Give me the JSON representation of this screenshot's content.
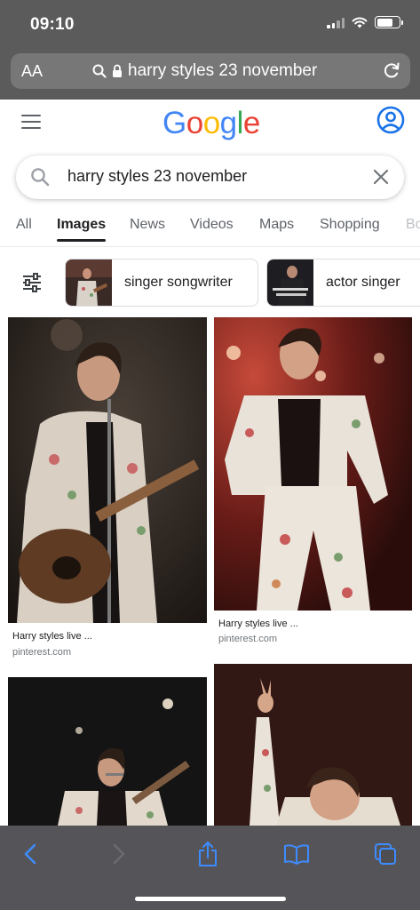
{
  "status_bar": {
    "time": "09:10",
    "battery_level": 0.72
  },
  "browser": {
    "text_size_label": "AA",
    "url_text": "harry styles 23 november",
    "icons": [
      "search-icon",
      "lock-icon",
      "reload-icon"
    ]
  },
  "google": {
    "logo_letters": [
      {
        "ch": "G",
        "color": "#4285F4"
      },
      {
        "ch": "o",
        "color": "#EA4335"
      },
      {
        "ch": "o",
        "color": "#FBBC05"
      },
      {
        "ch": "g",
        "color": "#4285F4"
      },
      {
        "ch": "l",
        "color": "#34A853"
      },
      {
        "ch": "e",
        "color": "#EA4335"
      }
    ],
    "search_value": "harry styles 23 november",
    "account_color": "#1a73e8"
  },
  "tabs": [
    {
      "label": "All"
    },
    {
      "label": "Images",
      "active": true
    },
    {
      "label": "News"
    },
    {
      "label": "Videos"
    },
    {
      "label": "Maps"
    },
    {
      "label": "Shopping"
    },
    {
      "label": "Bo"
    }
  ],
  "chips": [
    {
      "label": "singer songwriter"
    },
    {
      "label": "actor singer"
    }
  ],
  "results": [
    {
      "caption": "Harry styles live ...",
      "source": "pinterest.com"
    },
    {
      "caption": "Harry styles live ...",
      "source": "pinterest.com"
    },
    {
      "caption": "",
      "source": ""
    },
    {
      "caption": "",
      "source": ""
    }
  ],
  "toolbar": {
    "icons": [
      "back-icon",
      "forward-icon",
      "share-icon",
      "bookmarks-icon",
      "tabs-icon"
    ],
    "accent": "#3d8cff"
  }
}
